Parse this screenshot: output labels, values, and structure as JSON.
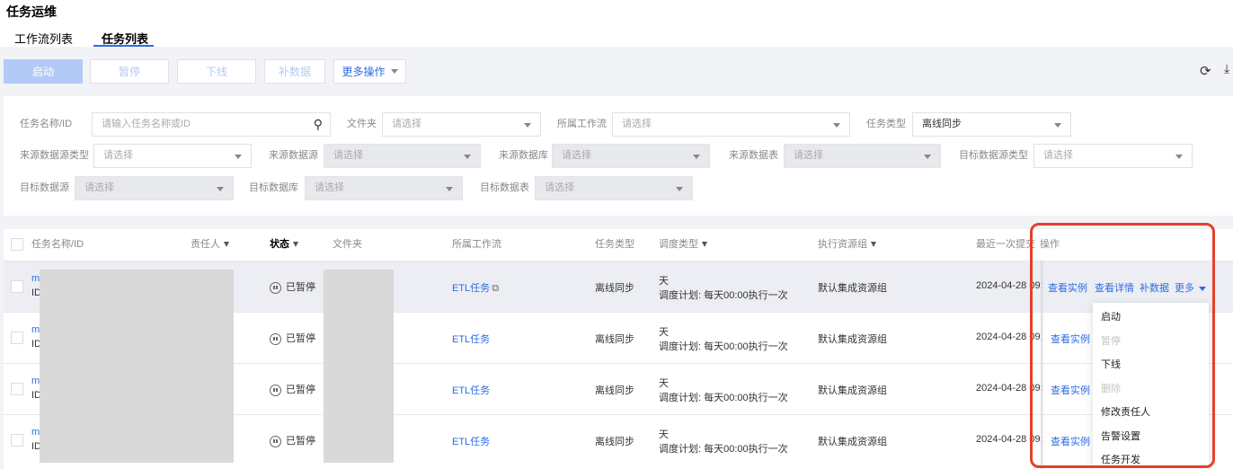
{
  "page_title": "任务运维",
  "tabs": [
    {
      "label": "工作流列表"
    },
    {
      "label": "任务列表",
      "active": true
    }
  ],
  "toolbar": {
    "start": "启动",
    "pause": "暂停",
    "offline": "下线",
    "backfill": "补数据",
    "more": "更多操作",
    "icons": [
      "refresh-icon",
      "download-icon"
    ]
  },
  "filters": {
    "task_name_label": "任务名称/ID",
    "task_name_placeholder": "请输入任务名称或ID",
    "folder_label": "文件夹",
    "folder_value": "请选择",
    "workflow_label": "所属工作流",
    "workflow_value": "请选择",
    "task_type_label": "任务类型",
    "task_type_value": "离线同步",
    "src_type_label": "来源数据源类型",
    "src_type_value": "请选择",
    "src_ds_label": "来源数据源",
    "src_ds_value": "请选择",
    "src_db_label": "来源数据库",
    "src_db_value": "请选择",
    "src_tbl_label": "来源数据表",
    "src_tbl_value": "请选择",
    "dst_type_label": "目标数据源类型",
    "dst_type_value": "请选择",
    "dst_ds_label": "目标数据源",
    "dst_ds_value": "请选择",
    "dst_db_label": "目标数据库",
    "dst_db_value": "请选择",
    "dst_tbl_label": "目标数据表",
    "dst_tbl_value": "请选择"
  },
  "table": {
    "headers": {
      "name": "任务名称/ID",
      "owner": "责任人",
      "status": "状态",
      "folder": "文件夹",
      "workflow": "所属工作流",
      "type": "任务类型",
      "schedule": "调度类型",
      "group": "执行资源组",
      "last": "最近一次提交",
      "ops": "操作"
    },
    "rows": [
      {
        "name": "m",
        "id": "ID",
        "status": "已暂停",
        "workflow": "ETL任务",
        "type": "离线同步",
        "schedule": "天",
        "plan": "调度计划: 每天00:00执行一次",
        "group": "默认集成资源组",
        "last": "2024-04-28 09:"
      },
      {
        "name": "m",
        "id": "ID",
        "status": "已暂停",
        "workflow": "ETL任务",
        "type": "离线同步",
        "schedule": "天",
        "plan": "调度计划: 每天00:00执行一次",
        "group": "默认集成资源组",
        "last": "2024-04-28 09:"
      },
      {
        "name": "m",
        "id": "ID",
        "status": "已暂停",
        "workflow": "ETL任务",
        "type": "离线同步",
        "schedule": "天",
        "plan": "调度计划: 每天00:00执行一次",
        "group": "默认集成资源组",
        "last": "2024-04-28 09:"
      },
      {
        "name": "m",
        "id": "ID",
        "status": "已暂停",
        "workflow": "ETL任务",
        "type": "离线同步",
        "schedule": "天",
        "plan": "调度计划: 每天00:00执行一次",
        "group": "默认集成资源组",
        "last": "2024-04-28 09:"
      }
    ],
    "row_ops": {
      "view_instances": "查看实例",
      "view_details": "查看详情",
      "backfill": "补数据",
      "more": "更多"
    }
  },
  "more_menu": [
    {
      "label": "启动"
    },
    {
      "label": "暂停",
      "disabled": true
    },
    {
      "label": "下线"
    },
    {
      "label": "删除",
      "disabled": true
    },
    {
      "label": "修改责任人"
    },
    {
      "label": "告警设置"
    },
    {
      "label": "任务开发"
    }
  ],
  "colors": {
    "accent": "#2b6de5",
    "highlight": "#e5402a"
  }
}
